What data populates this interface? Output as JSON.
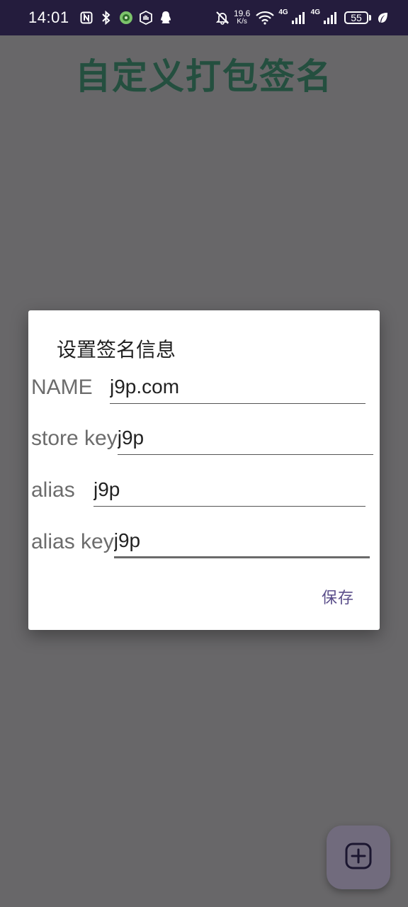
{
  "status_bar": {
    "time": "14:01",
    "net_speed": "19.6",
    "net_unit": "K/s",
    "signal_1_label": "4G",
    "signal_2_label": "4G",
    "battery": "55",
    "icons": [
      "nfc-icon",
      "bluetooth-icon",
      "app-badge-icon",
      "hand-icon",
      "qq-icon",
      "mute-bell-icon",
      "wifi-icon",
      "signal-icon",
      "leaf-icon"
    ]
  },
  "page": {
    "title": "自定义打包签名"
  },
  "dialog": {
    "title": "设置签名信息",
    "fields": [
      {
        "label": "NAME",
        "value": "j9p.com"
      },
      {
        "label": "store key",
        "value": "j9p"
      },
      {
        "label": "alias",
        "value": "j9p"
      },
      {
        "label": "alias key",
        "value": "j9p"
      }
    ],
    "save_label": "保存"
  },
  "fab": {
    "icon": "add-square-icon"
  },
  "colors": {
    "status_bar": "#241c3d",
    "scrim_background": "#686769",
    "title": "#244f3f",
    "accent": "#5a4e8a",
    "fab": "#716b7d"
  }
}
